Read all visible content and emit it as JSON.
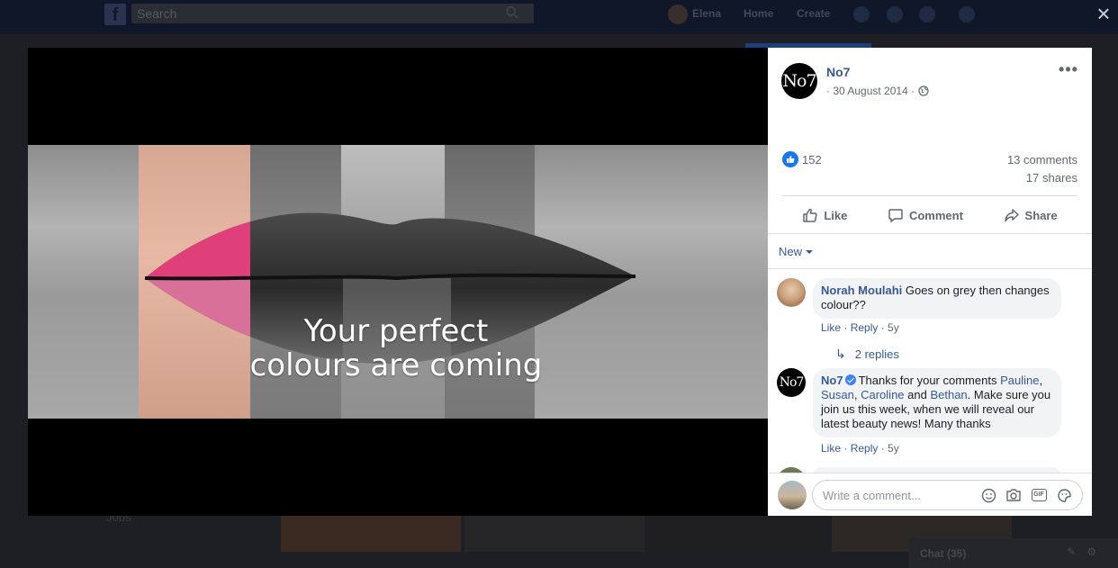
{
  "background": {
    "search_placeholder": "Search",
    "user_name": "Elena",
    "nav_home": "Home",
    "nav_create": "Create",
    "sidebar_jobs": "Jobs",
    "chat_label": "Chat (35)"
  },
  "overlay": {
    "close_icon": "close-icon"
  },
  "media": {
    "headline_line1": "Your perfect",
    "headline_line2": "colours are coming"
  },
  "post": {
    "page_name": "No7",
    "page_logo_text": "No7",
    "date": "· 30 August 2014 ·",
    "privacy_icon": "globe-icon",
    "reaction_count": "152",
    "comments_count": "13 comments",
    "shares_count": "17 shares",
    "actions": {
      "like": "Like",
      "comment": "Comment",
      "share": "Share"
    },
    "sort_label": "New"
  },
  "comments": [
    {
      "author": "Norah Moulahi",
      "text": "Goes on grey then changes colour??",
      "like": "Like",
      "reply": "Reply",
      "age": "5y",
      "replies": "2 replies"
    },
    {
      "author": "No7",
      "verified": true,
      "text_1": "Thanks for your comments ",
      "mention_1": "Pauline",
      "sep_1": ",",
      "mention_2": "Susan",
      "sep_2": ", ",
      "mention_3": "Caroline",
      "sep_3": " and ",
      "mention_4": "Bethan",
      "text_2": ". Make sure you join us this week, when we will reveal our latest beauty news! Many thanks",
      "like": "Like",
      "reply": "Reply",
      "age": "5y"
    }
  ],
  "composer": {
    "placeholder": "Write a comment...",
    "tools": [
      "emoji-icon",
      "camera-icon",
      "gif-icon",
      "sticker-icon"
    ]
  },
  "colors": {
    "link_blue": "#385898",
    "like_blue": "#1877f2",
    "fb_dark_bar": "#0f1729"
  }
}
